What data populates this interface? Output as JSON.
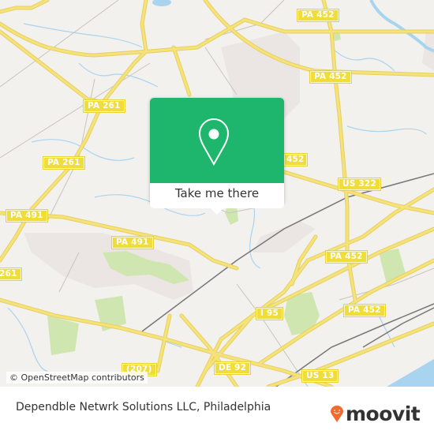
{
  "map": {
    "attribution": "© OpenStreetMap contributors",
    "road_labels": [
      {
        "id": "pa452-top",
        "text": "PA 452"
      },
      {
        "id": "pa452-upper",
        "text": "PA 452"
      },
      {
        "id": "pa261-upper",
        "text": "PA 261"
      },
      {
        "id": "pa261-lower",
        "text": "PA 261"
      },
      {
        "id": "pa491-left",
        "text": "PA 491"
      },
      {
        "id": "pa491-mid",
        "text": "PA 491"
      },
      {
        "id": "pa261-edge",
        "text": "261"
      },
      {
        "id": "pa452-hidden",
        "text": "452"
      },
      {
        "id": "us322",
        "text": "US 322"
      },
      {
        "id": "pa452-mid",
        "text": "PA 452"
      },
      {
        "id": "pa452-right",
        "text": "PA 452"
      },
      {
        "id": "i95",
        "text": "I 95"
      },
      {
        "id": "de92",
        "text": "DE 92"
      },
      {
        "id": "us13",
        "text": "US 13"
      },
      {
        "id": "r207",
        "text": "(207)"
      }
    ],
    "colors": {
      "land": "#f2f1ee",
      "road": "#f5e27a",
      "road_casing": "#e6d060",
      "water": "#a9d4ef",
      "park": "#cfe6b0",
      "urban": "#ebe6e4",
      "rail": "#777777"
    }
  },
  "popup": {
    "icon": "map-pin-icon",
    "button_label": "Take me there",
    "accent_color": "#1eb66d"
  },
  "footer": {
    "title": "Dependble Netwrk Solutions LLC, Philadelphia",
    "logo_text": "moovit",
    "logo_icon": "moovit-pin-icon",
    "logo_color": "#f26a2e"
  }
}
